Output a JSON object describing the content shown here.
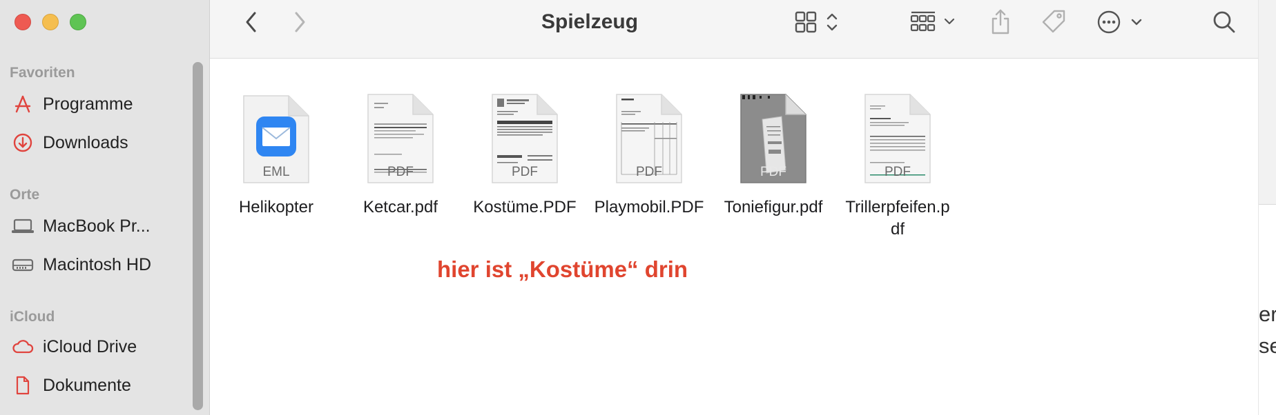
{
  "window": {
    "title": "Spielzeug"
  },
  "sidebar": {
    "sections": [
      {
        "title": "Favoriten",
        "items": [
          {
            "label": "Programme",
            "icon": "apps-icon"
          },
          {
            "label": "Downloads",
            "icon": "download-circle-icon"
          }
        ]
      },
      {
        "title": "Orte",
        "items": [
          {
            "label": "MacBook Pr...",
            "icon": "laptop-icon"
          },
          {
            "label": "Macintosh HD",
            "icon": "hard-drive-icon"
          }
        ]
      },
      {
        "title": "iCloud",
        "items": [
          {
            "label": "iCloud Drive",
            "icon": "cloud-icon"
          },
          {
            "label": "Dokumente",
            "icon": "document-icon"
          }
        ]
      }
    ]
  },
  "toolbar": {
    "icons": [
      "back-icon",
      "forward-icon",
      "icon-view-icon",
      "group-icon",
      "share-icon",
      "tag-icon",
      "more-icon",
      "search-icon"
    ]
  },
  "files": [
    {
      "name": "Helikopter",
      "kind": "EML"
    },
    {
      "name": "Ketcar.pdf",
      "kind": "PDF"
    },
    {
      "name": "Kostüme.PDF",
      "kind": "PDF"
    },
    {
      "name": "Playmobil.PDF",
      "kind": "PDF"
    },
    {
      "name": "Toniefigur.pdf",
      "kind": "PDF"
    },
    {
      "name": "Trillerpfeifen.p\ndf",
      "kind": "PDF"
    }
  ],
  "annotation": {
    "text": "hier ist „Kostüme“ drin",
    "color": "#e0452f"
  },
  "right_fragment": {
    "line1": "er",
    "line2": "se"
  },
  "colors": {
    "sidebar_bg": "#e4e4e4",
    "sidebar_icon": "#e0443e",
    "toolbar_bg": "#f5f5f5",
    "mail_icon": "#2f86f2"
  }
}
